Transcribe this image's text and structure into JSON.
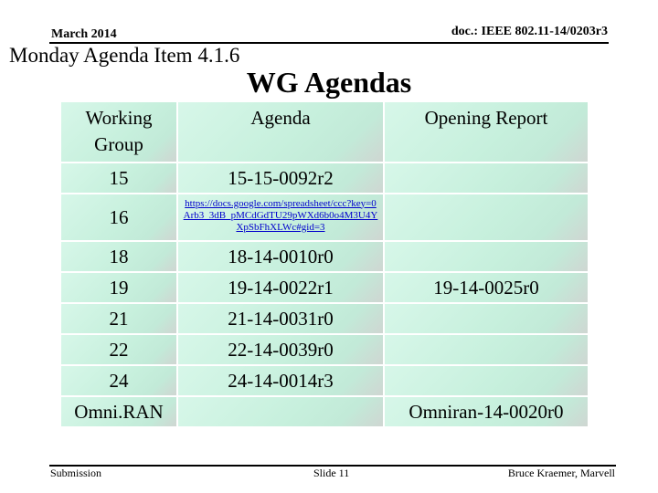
{
  "header": {
    "date": "March 2014",
    "doc_id": "doc.: IEEE 802.11-14/0203r3"
  },
  "subtitle": "Monday Agenda Item 4.1.6",
  "title": "WG Agendas",
  "table": {
    "columns": [
      "Working Group",
      "Agenda",
      "Opening Report"
    ],
    "rows": [
      {
        "group": "15",
        "agenda": "15-15-0092r2",
        "report": ""
      },
      {
        "group": "16",
        "agenda": "https://docs.google.com/spreadsheet/ccc?key=0Arb3_3dB_pMCdGdTU29pWXd6b0o4M3U4YXpSbFhXLWc#gid=3",
        "report": ""
      },
      {
        "group": "18",
        "agenda": "18-14-0010r0",
        "report": ""
      },
      {
        "group": "19",
        "agenda": "19-14-0022r1",
        "report": "19-14-0025r0"
      },
      {
        "group": "21",
        "agenda": "21-14-0031r0",
        "report": ""
      },
      {
        "group": "22",
        "agenda": "22-14-0039r0",
        "report": ""
      },
      {
        "group": "24",
        "agenda": "24-14-0014r3",
        "report": ""
      },
      {
        "group": "Omni.RAN",
        "agenda": "",
        "report": "Omniran-14-0020r0"
      }
    ]
  },
  "footer": {
    "left": "Submission",
    "center": "Slide 11",
    "right": "Bruce Kraemer, Marvell"
  },
  "colors": {
    "cell_bg": "#c7f0dd",
    "link": "#0000cc"
  }
}
